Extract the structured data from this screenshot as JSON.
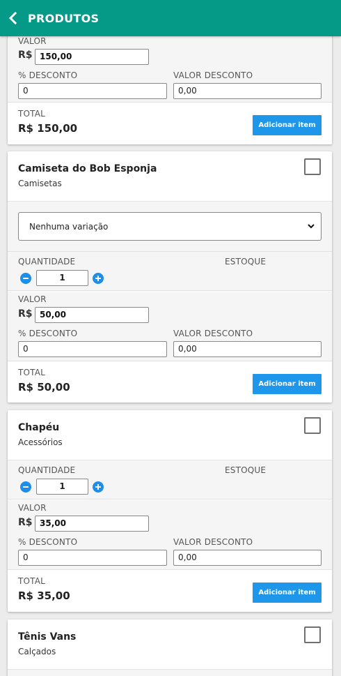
{
  "header": {
    "title": "PRODUTOS",
    "back_icon": "chevron-left-icon"
  },
  "labels": {
    "quantidade": "QUANTIDADE",
    "estoque": "ESTOQUE",
    "valor": "VALOR",
    "desconto_pct": "% DESCONTO",
    "valor_desconto": "VALOR DESCONTO",
    "total": "TOTAL",
    "currency": "R$",
    "add_button": "Adicionar item"
  },
  "products": [
    {
      "valor": "150,00",
      "desconto": "0",
      "valor_desconto": "0,00",
      "total": "R$ 150,00"
    },
    {
      "name": "Camiseta do Bob Esponja",
      "category": "Camisetas",
      "variation": "Nenhuma variação",
      "quantity": "1",
      "valor": "50,00",
      "desconto": "0",
      "valor_desconto": "0,00",
      "total": "R$ 50,00"
    },
    {
      "name": "Chapéu",
      "category": "Acessórios",
      "quantity": "1",
      "valor": "35,00",
      "desconto": "0",
      "valor_desconto": "0,00",
      "total": "R$ 35,00"
    },
    {
      "name": "Tênis Vans",
      "category": "Calçados"
    }
  ],
  "colors": {
    "appbar": "#049a87",
    "button": "#1e96ea",
    "stepper": "#1e8ee8"
  }
}
